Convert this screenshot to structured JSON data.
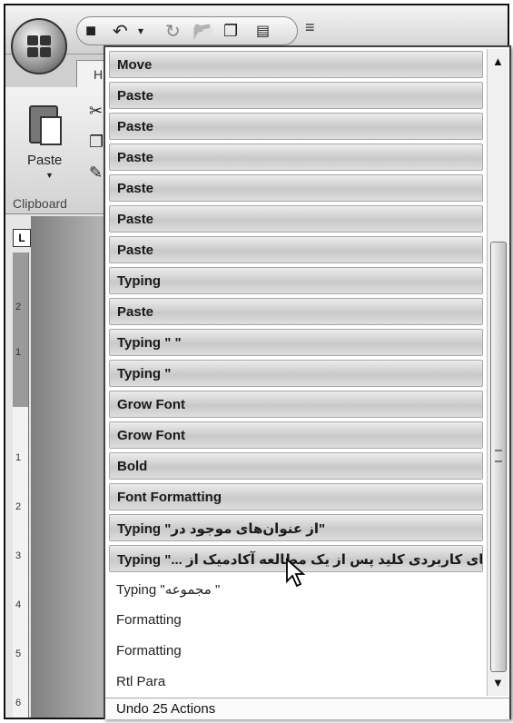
{
  "ribbon": {
    "tab_home": "H",
    "paste_label": "Paste",
    "clipboard_label": "Clipboard"
  },
  "ruler": {
    "corner": "L",
    "numbers": [
      "2",
      "1",
      "1",
      "2",
      "3",
      "4",
      "5",
      "6"
    ]
  },
  "undo_list": {
    "items": [
      "Move",
      "Paste",
      "Paste",
      "Paste",
      "Paste",
      "Paste",
      "Paste",
      "Typing",
      "Paste",
      "Typing \" \"",
      "Typing \"",
      "Grow Font",
      "Grow Font",
      "Bold",
      "Font Formatting",
      "Typing \"از عنوان‌های موجود در\"",
      "Typing \"... کتاب‌های کاربردی کلید پس از یک مطالعه آکادمیک از\"",
      "Typing \"مجموعه \"",
      "Formatting",
      "Formatting",
      "Rtl Para"
    ],
    "selected_count": 17,
    "footer": "Undo 25 Actions"
  },
  "icons": {
    "office_button": "office-logo-icon",
    "save": "save-icon",
    "undo": "undo-icon",
    "redo": "redo-icon",
    "open": "open-folder-icon",
    "customize": "customize-qat-icon"
  }
}
